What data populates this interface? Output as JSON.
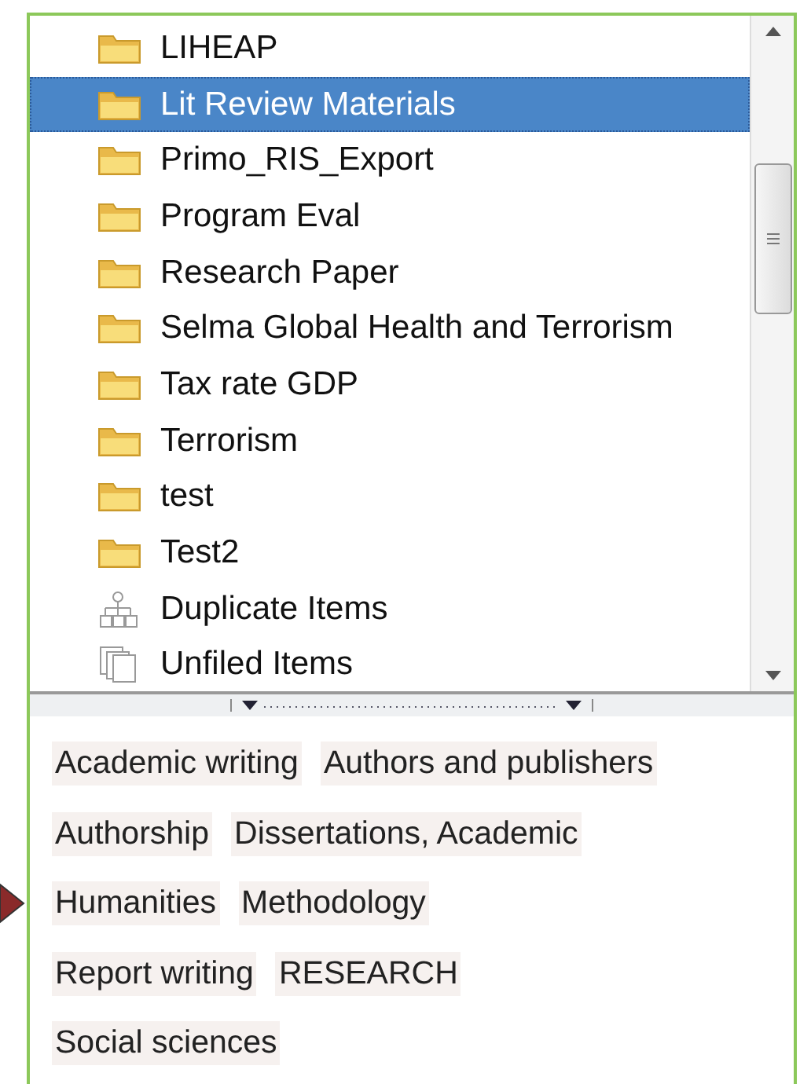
{
  "collections": [
    {
      "label": "LIHEAP",
      "kind": "folder",
      "selected": false
    },
    {
      "label": "Lit Review Materials",
      "kind": "folder",
      "selected": true
    },
    {
      "label": "Primo_RIS_Export",
      "kind": "folder",
      "selected": false
    },
    {
      "label": "Program Eval",
      "kind": "folder",
      "selected": false
    },
    {
      "label": "Research Paper",
      "kind": "folder",
      "selected": false
    },
    {
      "label": "Selma Global Health and Terrorism",
      "kind": "folder",
      "selected": false
    },
    {
      "label": "Tax rate GDP",
      "kind": "folder",
      "selected": false
    },
    {
      "label": "Terrorism",
      "kind": "folder",
      "selected": false
    },
    {
      "label": "test",
      "kind": "folder",
      "selected": false
    },
    {
      "label": "Test2",
      "kind": "folder",
      "selected": false
    },
    {
      "label": "Duplicate Items",
      "kind": "duplicates",
      "selected": false
    },
    {
      "label": "Unfiled Items",
      "kind": "unfiled",
      "selected": false
    }
  ],
  "tag_rows": [
    {
      "tags": [
        "Academic writing",
        "Authors and publishers"
      ],
      "pointed": false
    },
    {
      "tags": [
        "Authorship",
        "Dissertations, Academic"
      ],
      "pointed": false
    },
    {
      "tags": [
        "Humanities",
        "Methodology"
      ],
      "pointed": true
    },
    {
      "tags": [
        "Report writing",
        "RESEARCH"
      ],
      "pointed": false
    },
    {
      "tags": [
        "Social sciences"
      ],
      "pointed": false
    }
  ]
}
